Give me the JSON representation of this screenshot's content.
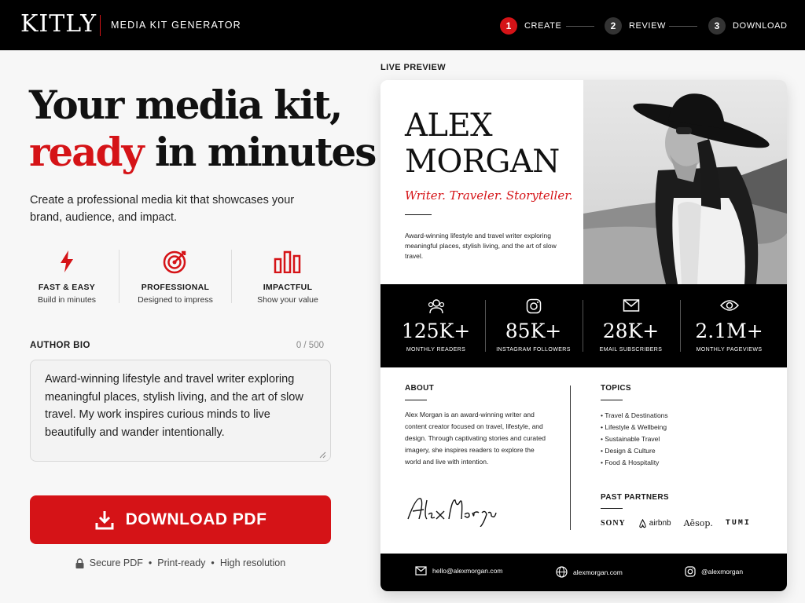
{
  "header": {
    "logo": "KITLY",
    "app_name": "MEDIA KIT GENERATOR",
    "steps": [
      {
        "num": "1",
        "label": "CREATE"
      },
      {
        "num": "2",
        "label": "REVIEW"
      },
      {
        "num": "3",
        "label": "DOWNLOAD"
      }
    ],
    "active_step": 1
  },
  "hero": {
    "line1": "Your media kit,",
    "accent": "ready",
    "line2_rest": " in minutes",
    "subtitle": "Create a professional media kit that showcases your brand, audience, and impact."
  },
  "features": [
    {
      "icon": "lightning-icon",
      "title": "FAST & EASY",
      "subtitle": "Build in minutes"
    },
    {
      "icon": "target-icon",
      "title": "PROFESSIONAL",
      "subtitle": "Designed to impress"
    },
    {
      "icon": "bar-chart-icon",
      "title": "IMPACTFUL",
      "subtitle": "Show your value"
    }
  ],
  "bio": {
    "label": "AUTHOR BIO",
    "count": "0 / 500",
    "value": "Award-winning lifestyle and travel writer exploring meaningful places, stylish living, and the art of slow travel. My work inspires curious minds to live beautifully and wander intentionally."
  },
  "download": {
    "label": "DOWNLOAD PDF",
    "badges": [
      "Secure PDF",
      "Print-ready",
      "High resolution"
    ]
  },
  "preview": {
    "label": "LIVE PREVIEW",
    "name_line1": "ALEX",
    "name_line2": "MORGAN",
    "tagline": "Writer. Traveler. Storyteller.",
    "intro": "Award-winning lifestyle and travel writer exploring meaningful places, stylish living, and the art of slow travel.",
    "stats": [
      {
        "icon": "users-icon",
        "value": "125K+",
        "label": "MONTHLY READERS"
      },
      {
        "icon": "instagram-icon",
        "value": "85K+",
        "label": "INSTAGRAM FOLLOWERS"
      },
      {
        "icon": "mail-icon",
        "value": "28K+",
        "label": "EMAIL SUBSCRIBERS"
      },
      {
        "icon": "eye-icon",
        "value": "2.1M+",
        "label": "MONTHLY PAGEVIEWS"
      }
    ],
    "about_title": "ABOUT",
    "about_text": "Alex Morgan is an award-winning writer and content creator focused on travel, lifestyle, and design. Through captivating stories and curated imagery, she inspires readers to explore the world and live with intention.",
    "signature": "Alex Morgan",
    "topics_title": "TOPICS",
    "topics": [
      "Travel & Destinations",
      "Lifestyle & Wellbeing",
      "Sustainable Travel",
      "Design & Culture",
      "Food & Hospitality"
    ],
    "partners_title": "PAST PARTNERS",
    "partners": [
      "SONY",
      "airbnb",
      "Aēsop.",
      "TUMI"
    ],
    "footer": {
      "email": "hello@alexmorgan.com",
      "website": "alexmorgan.com",
      "instagram": "@alexmorgan"
    }
  },
  "colors": {
    "accent": "#d51317",
    "dark": "#000000",
    "background": "#f7f7f7"
  }
}
